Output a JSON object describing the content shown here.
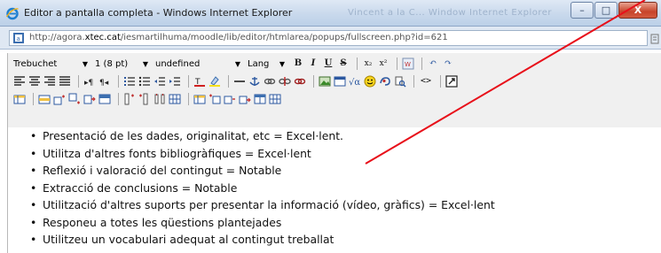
{
  "window": {
    "title": "Editor a pantalla completa - Windows Internet Explorer",
    "blurred_title_suffix": "Vincent a la C... Window Internet Explorer",
    "minimize_glyph": "–",
    "maximize_glyph": "□",
    "close_glyph": "X"
  },
  "address": {
    "url_prefix": "http://agora.",
    "url_domain": "xtec.cat",
    "url_suffix": "/iesmartilhuma/moodle/lib/editor/htmlarea/popups/fullscreen.php?id=621",
    "trailing_icon": "page-icon"
  },
  "toolbar": {
    "font_family": "Trebuchet",
    "font_size": "1 (8 pt)",
    "format": "undefined",
    "lang": "Lang",
    "bold": "B",
    "italic": "I",
    "underline": "U",
    "strike": "S",
    "subscript": "x₂",
    "superscript": "x²",
    "undo": "↶",
    "redo": "↷",
    "html_source": "<>"
  },
  "content": {
    "items": [
      "Presentació de les dades, originalitat, etc = Excel·lent.",
      "Utilitza d'altres fonts bibliogràfiques = Excel·lent",
      "Reflexió i valoració del contingut = Notable",
      "Extracció de conclusions = Notable",
      "Utilització d'altres suports per presentar la informació (vídeo, gràfics) = Excel·lent",
      "Responeu a totes les qüestions plantejades",
      "Utilitzeu un vocabulari adequat al contingut treballat"
    ]
  },
  "colors": {
    "annotation_line": "#e8101a",
    "titlebar": "#c9d9ec",
    "close_button": "#c7442a"
  }
}
